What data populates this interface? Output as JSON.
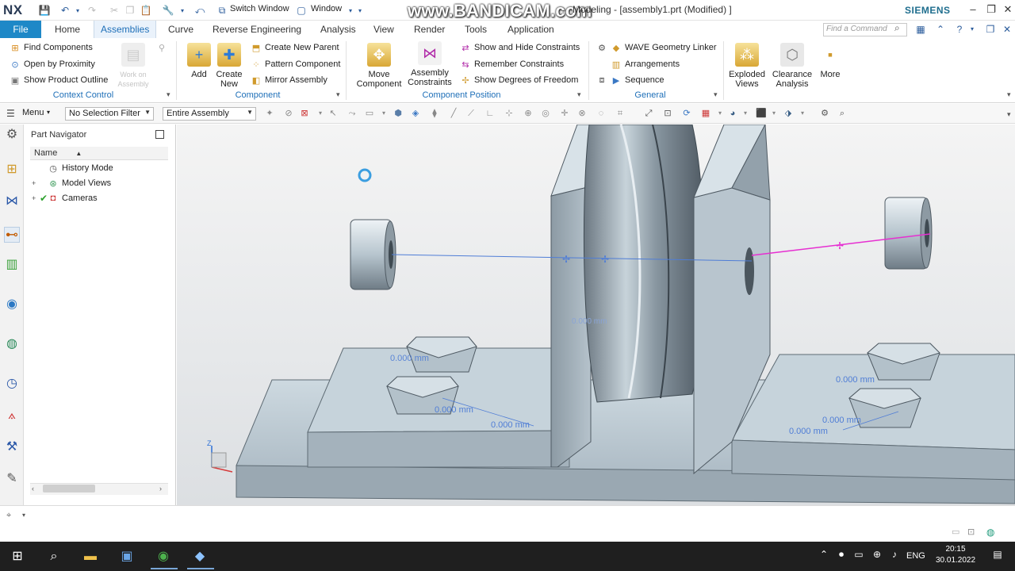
{
  "app": {
    "logo": "NX",
    "watermark": "www.BANDICAM.com",
    "window_title": "Modeling - [assembly1.prt (Modified) ]",
    "brand": "SIEMENS",
    "switch_window_label": "Switch Window",
    "window_menu_label": "Window"
  },
  "tabs": [
    "File",
    "Home",
    "Assemblies",
    "Curve",
    "Reverse Engineering",
    "Analysis",
    "View",
    "Render",
    "Tools",
    "Application"
  ],
  "active_tab": "Assemblies",
  "command_search": {
    "placeholder": "Find a Command"
  },
  "ribbon": {
    "context_control": {
      "label": "Context Control",
      "items": [
        "Find Components",
        "Open by Proximity",
        "Show Product Outline"
      ],
      "disabled_big": "Work on Assembly"
    },
    "component": {
      "label": "Component",
      "add": "Add",
      "create_new": "Create New",
      "items": [
        "Create New Parent",
        "Pattern Component",
        "Mirror Assembly"
      ]
    },
    "component_position": {
      "label": "Component Position",
      "move_component": "Move Component",
      "assembly_constraints": "Assembly Constraints",
      "items": [
        "Show and Hide Constraints",
        "Remember Constraints",
        "Show Degrees of Freedom"
      ]
    },
    "general": {
      "label": "General",
      "items": [
        "WAVE Geometry Linker",
        "Arrangements",
        "Sequence"
      ]
    },
    "exploded_views": "Exploded Views",
    "clearance_analysis": "Clearance Analysis",
    "more": "More"
  },
  "selection_bar": {
    "menu_label": "Menu",
    "filter": "No Selection Filter",
    "scope": "Entire Assembly"
  },
  "navigator": {
    "title": "Part Navigator",
    "column_name": "Name",
    "items": [
      {
        "label": "History Mode"
      },
      {
        "label": "Model Views"
      },
      {
        "label": "Cameras"
      }
    ]
  },
  "viewport": {
    "dimensions": [
      "0.000 mm",
      "0.000 mm",
      "0.000 mm",
      "0.000 mm",
      "0.000 mm",
      "0.000 mm",
      "0.000 mm"
    ],
    "axis_label": "Z"
  },
  "taskbar": {
    "language": "ENG",
    "time": "20:15",
    "date": "30.01.2022"
  },
  "colors": {
    "accent": "#1e88c7",
    "tab_active_text": "#1e6fb8",
    "brand": "#1f6e8e",
    "constraint_line": "#4f7dd6",
    "constraint_magenta": "#e62fd1",
    "part_face": "#b9c9d3"
  }
}
